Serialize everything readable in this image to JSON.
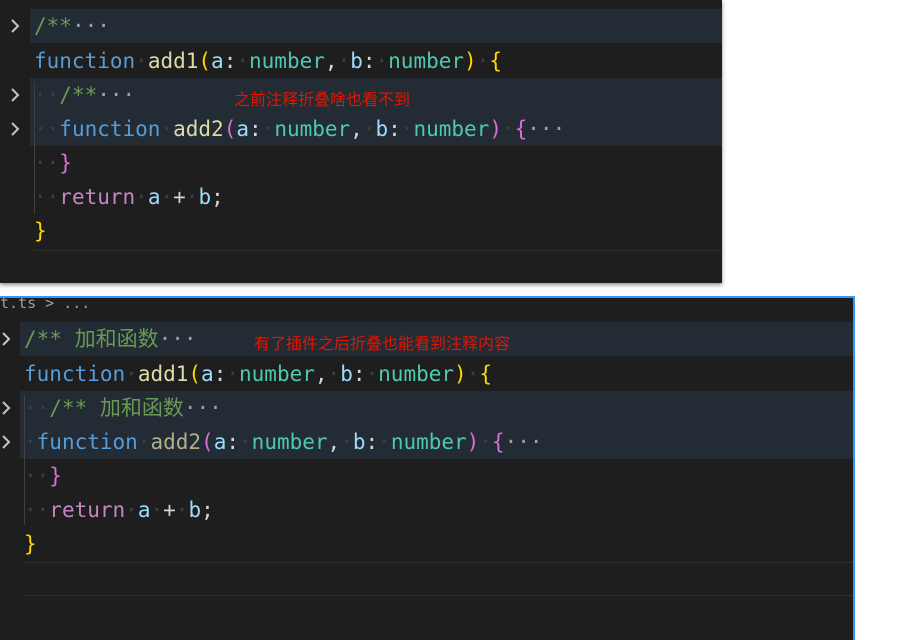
{
  "colors": {
    "background": "#1e1e1e",
    "comment": "#6a9955",
    "keyword": "#569cd6",
    "function": "#dcdcaa",
    "parameter": "#9cdcfe",
    "type": "#4ec9b0",
    "annotation": "#e51400",
    "focus_border": "#3794ff"
  },
  "top": {
    "annotation": "之前注释折叠啥也看不到",
    "line1": {
      "comment": "/**",
      "ellipsis": "···"
    },
    "line2": {
      "kw": "function",
      "name": "add1",
      "open": "(",
      "p1": "a",
      "colon1": ":",
      "t1": "number",
      "comma": ",",
      "p2": "b",
      "colon2": ":",
      "t2": "number",
      "close": ")",
      "brace": "{"
    },
    "line3": {
      "comment": "/**",
      "ellipsis": "···"
    },
    "line4": {
      "kw": "function",
      "name": "add2",
      "open": "(",
      "p1": "a",
      "colon1": ":",
      "t1": "number",
      "comma": ",",
      "p2": "b",
      "colon2": ":",
      "t2": "number",
      "close": ")",
      "brace": "{",
      "ellipsis": "···"
    },
    "line5": {
      "brace": "}"
    },
    "line6": {
      "kw": "return",
      "a": "a",
      "op": "+",
      "b": "b",
      "semi": ";"
    },
    "line7": {
      "brace": "}"
    }
  },
  "bottom": {
    "tab_fragment": "t.ts > ...",
    "annotation": "有了插件之后折叠也能看到注释内容",
    "line1": {
      "comment": "/** 加和函数",
      "ellipsis": "···"
    },
    "line2": {
      "kw": "function",
      "name": "add1",
      "open": "(",
      "p1": "a",
      "colon1": ":",
      "t1": "number",
      "comma": ",",
      "p2": "b",
      "colon2": ":",
      "t2": "number",
      "close": ")",
      "brace": "{"
    },
    "line3": {
      "comment": "/** 加和函数",
      "ellipsis": "···"
    },
    "line4": {
      "kw": "function",
      "name": "add2",
      "open": "(",
      "p1": "a",
      "colon1": ":",
      "t1": "number",
      "comma": ",",
      "p2": "b",
      "colon2": ":",
      "t2": "number",
      "close": ")",
      "brace": "{",
      "ellipsis": "···"
    },
    "line5": {
      "brace": "}"
    },
    "line6": {
      "kw": "return",
      "a": "a",
      "op": "+",
      "b": "b",
      "semi": ";"
    },
    "line7": {
      "brace": "}"
    }
  }
}
